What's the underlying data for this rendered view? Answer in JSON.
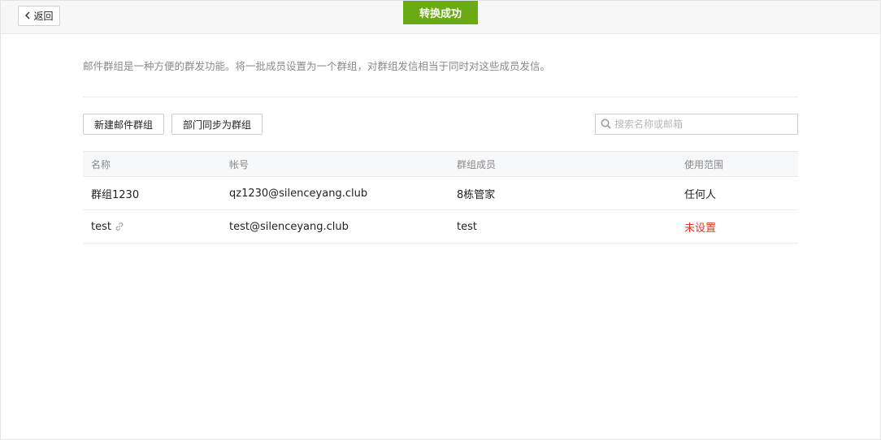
{
  "header": {
    "back_label": "返回",
    "toast": "转换成功"
  },
  "intro": "邮件群组是一种方便的群发功能。将一批成员设置为一个群组，对群组发信相当于同时对这些成员发信。",
  "toolbar": {
    "new_group_label": "新建邮件群组",
    "sync_label": "部门同步为群组"
  },
  "search": {
    "placeholder": "搜索名称或邮箱",
    "value": ""
  },
  "table": {
    "columns": [
      "名称",
      "帐号",
      "群组成员",
      "使用范围"
    ],
    "rows": [
      {
        "name": "群组1230",
        "account": "qz1230@silenceyang.club",
        "members": "8栋管家",
        "scope": "任何人"
      },
      {
        "name": "test",
        "account": "test@silenceyang.club",
        "members": "test",
        "scope": "未设置"
      }
    ]
  },
  "colors": {
    "toast_bg": "#6aaa12",
    "unset_text": "#d9352a"
  },
  "icons": [
    "chevron-left-icon",
    "search-icon",
    "link-icon"
  ]
}
